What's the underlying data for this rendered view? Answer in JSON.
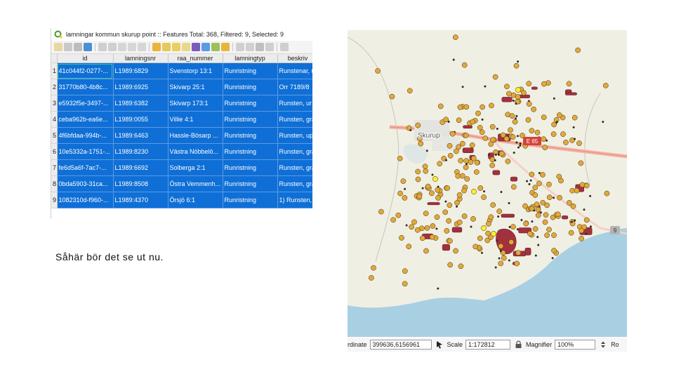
{
  "attribute_table": {
    "title": "lamningar kommun skurup point :: Features Total: 368, Filtered: 9, Selected: 9",
    "columns": [
      "id",
      "lamningsnr",
      "raa_nummer",
      "lamningtyp",
      "beskriv"
    ],
    "rows": [
      {
        "n": "1",
        "id": "41c044f2-0277-...",
        "lamningsnr": "L1989:6829",
        "raa_nummer": "Svenstorp 13:1",
        "lamningtyp": "Runristning",
        "beskriv": "Runstenar, u"
      },
      {
        "n": "2",
        "id": "31770b80-4b8c...",
        "lamningsnr": "L1989:6925",
        "raa_nummer": "Skivarp 25:1",
        "lamningtyp": "Runristning",
        "beskriv": "Orr 7189/8"
      },
      {
        "n": "3",
        "id": "e5932f5e-3497-...",
        "lamningsnr": "L1989:6382",
        "raa_nummer": "Skivarp 173:1",
        "lamningtyp": "Runristning",
        "beskriv": "Runsten, ur"
      },
      {
        "n": "4",
        "id": "ceba962b-ea6e...",
        "lamningsnr": "L1989:0055",
        "raa_nummer": "Villie 4:1",
        "lamningtyp": "Runristning",
        "beskriv": "Runsten, gra"
      },
      {
        "n": "5",
        "id": "4f6bfdaa-994b-...",
        "lamningsnr": "L1989:6463",
        "raa_nummer": "Hassle-Bösarp ...",
        "lamningtyp": "Runristning",
        "beskriv": "Runsten, up"
      },
      {
        "n": "6",
        "id": "10e5332a-1751-...",
        "lamningsnr": "L1989:8230",
        "raa_nummer": "Västra Nöbbelö...",
        "lamningtyp": "Runristning",
        "beskriv": "Runsten, gra"
      },
      {
        "n": "7",
        "id": "fe6d5a6f-7ac7-...",
        "lamningsnr": "L1989:6692",
        "raa_nummer": "Solberga 2:1",
        "lamningtyp": "Runristning",
        "beskriv": "Runsten, gra"
      },
      {
        "n": "8",
        "id": "0bda5903-31ca...",
        "lamningsnr": "L1989:8508",
        "raa_nummer": "Östra Vemmenh...",
        "lamningtyp": "Runristning",
        "beskriv": "Runsten, gra"
      },
      {
        "n": "9",
        "id": "1082310d-f960-...",
        "lamningsnr": "L1989:4370",
        "raa_nummer": "Örsjö 6:1",
        "lamningtyp": "Runristning",
        "beskriv": "1) Runsten,"
      }
    ]
  },
  "caption": "Såhär bör det se ut nu.",
  "map": {
    "labels": {
      "town": "Skurup",
      "road_e65": "E 65",
      "road_9": "9"
    },
    "colors": {
      "land": "#f0efe4",
      "sea": "#a9cfe3",
      "road": "#f3b3a4",
      "point": "#e1a93a",
      "selected": "#ffee33",
      "polygon": "#a3313d"
    }
  },
  "status_bar": {
    "coordinate_label": "rdinate",
    "coordinate_value": "399636,6156961",
    "scale_label": "Scale",
    "scale_value": "1:172812",
    "magnifier_label": "Magnifier",
    "magnifier_value": "100%",
    "rotation_label": "Ro"
  }
}
